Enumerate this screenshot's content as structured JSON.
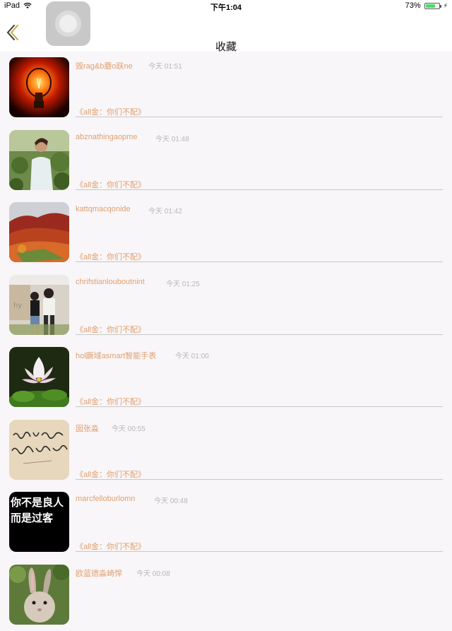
{
  "status_bar": {
    "device": "iPad",
    "time": "下午1:04",
    "battery": "73%",
    "battery_level": 0.73,
    "battery_color": "#4cd964"
  },
  "nav": {
    "title": "收藏",
    "back_icon": "chevron-left-icon"
  },
  "accent_color": "#e0a070",
  "items": [
    {
      "name": "毁rag&b蘑o趺ne",
      "time": "今天 01:51",
      "subtitle": "《all金：你们不配》",
      "thumb": "light-bulb"
    },
    {
      "name": "abznathingaopme",
      "time": "今天 01:48",
      "subtitle": "《all金：你们不配》",
      "thumb": "boy-in-field"
    },
    {
      "name": "kattqmacqonide",
      "time": "今天 01:42",
      "subtitle": "《all金：你们不配》",
      "thumb": "red-hills"
    },
    {
      "name": "chrifstianlouboutnint",
      "time": "今天 01:25",
      "subtitle": "《all金：你们不配》",
      "thumb": "couple"
    },
    {
      "name": "hol蹶域asmart智能手表",
      "time": "今天 01:00",
      "subtitle": "《all金：你们不配》",
      "thumb": "lotus"
    },
    {
      "name": "囡张淼",
      "time": "今天 00:55",
      "subtitle": "《all金：你们不配》",
      "thumb": "handwriting"
    },
    {
      "name": "marcfelloburlomn",
      "time": "今天 00:48",
      "subtitle": "《all金：你们不配》",
      "thumb": "text-image",
      "thumb_text": [
        "你不是良人",
        "而是过客"
      ]
    },
    {
      "name": "欧蓝德淼崎悍",
      "time": "今天 00:08",
      "subtitle": "",
      "thumb": "rabbit"
    }
  ]
}
